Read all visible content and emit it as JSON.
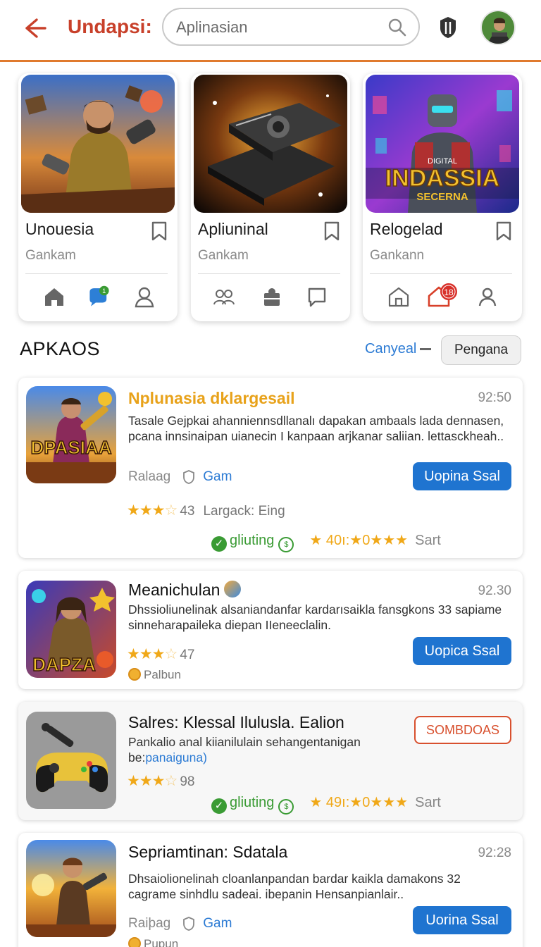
{
  "header": {
    "app_title": "Undapsi:",
    "search_placeholder": "Aplinasian"
  },
  "featured": [
    {
      "title": "Unouesia",
      "subtitle": "Gankam",
      "art_text": ""
    },
    {
      "title": "Apliuninal",
      "subtitle": "Gankam",
      "art_text": ""
    },
    {
      "title": "Relogelad",
      "subtitle": "Gankann",
      "art_text": "INDASSIA",
      "art_sub": "SECERNA",
      "art_top": "DIGITAL"
    }
  ],
  "featured_badges": {
    "chat_badge": "1",
    "home_badge": "18"
  },
  "section": {
    "title": "APKAOS",
    "link": "Canyeal",
    "button": "Pengana"
  },
  "list": [
    {
      "name": "Nplunasia dklargesail",
      "time": "92:50",
      "desc": "Tasale Gejpkai ahanniennsdllanalı dapakan ambaals lada dennasen, pcana innsinaipan uianecin I kanpaan arjkanar saliian. lettasckheah..",
      "meta_left": "Ralaag",
      "meta_tag": "Gam",
      "action": "Uopina Ssal",
      "rating": "43",
      "rating_label": "Largack: Eing",
      "status": "gliuting",
      "score": "40ı:",
      "score_tail": "0",
      "sart": "Sart",
      "art_text": "DPASIAA"
    },
    {
      "name": "Meanichulan",
      "time": "92.30",
      "desc": "Dhssioliunelinak alsaniandanfar kardarısaikla fansgkons 33 sapiame sinneharapaileka diepan IIeneeclalin.",
      "action": "Uopica Ssal",
      "rating": "47",
      "sub_label": "Palbun",
      "art_text": "DAPZA"
    },
    {
      "name": "Salres: Klessal Ilulusla. Ealion",
      "desc_a": "Pankalio anal kiianilulain sehangentanigan",
      "desc_b": "be:",
      "desc_hl": "panaiguna)",
      "action": "SOMBDOAS",
      "rating": "98",
      "status": "gliuting",
      "score": "49ı:",
      "score_tail": "0",
      "sart": "Sart"
    },
    {
      "name": "Sepriamtinan: Sdatala",
      "time": "92:28",
      "desc": "Dhsaiolionelinah cloanlanpandan bardar kaikla damakons 32 cagrame sinhdlu sadeai. ibepanin Hensanpianlair..",
      "meta_left": "Raiþag",
      "meta_tag": "Gam",
      "action": "Uorina Ssal",
      "sub_label": "Pupun"
    }
  ],
  "colors": {
    "accent": "#c8402a",
    "divider": "#e07a2e",
    "primary_button": "#1f74d0",
    "star": "#f0a818",
    "success": "#3a9b34"
  },
  "icons": {
    "back": "arrow-left-icon",
    "search": "search-icon",
    "shield": "shield-icon",
    "bookmark": "bookmark-icon"
  }
}
